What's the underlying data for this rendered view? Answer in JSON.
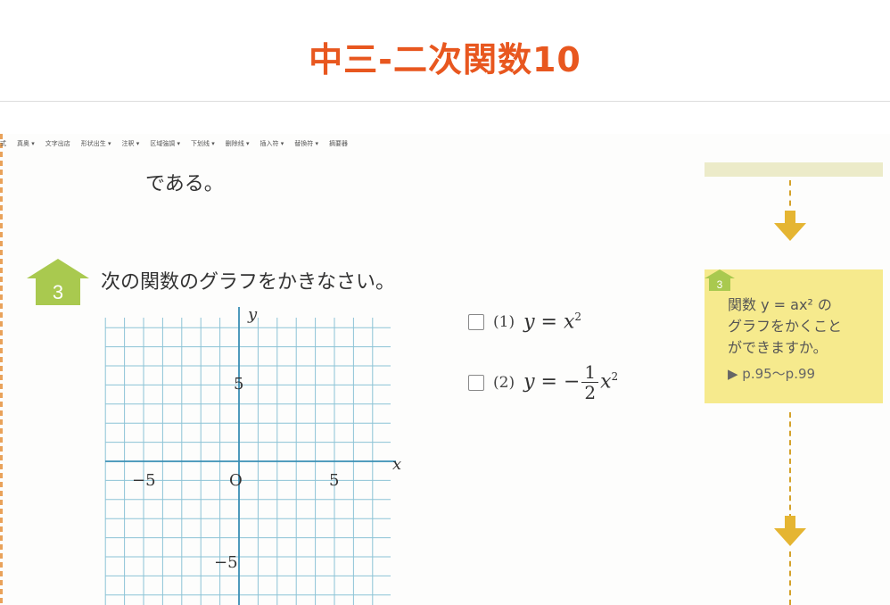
{
  "page": {
    "title": "中三-二次関数10"
  },
  "toolbar": {
    "items": [
      "式",
      "真奥 ▾",
      "文字出店",
      "形状出生 ▾",
      "注釈 ▾",
      "区域強調 ▾",
      "下划线 ▾",
      "删除线 ▾",
      "插入符 ▾",
      "替換符 ▾",
      "摘要器"
    ]
  },
  "document": {
    "preceding_text": "である。",
    "problem_number": "3",
    "problem_text": "次の関数のグラフをかきなさい。",
    "graph": {
      "x_label": "x",
      "y_label": "y",
      "origin_label": "O",
      "x_tick_labels": [
        "−5",
        "5"
      ],
      "y_tick_labels": [
        "5",
        "−5"
      ],
      "x_range": [
        -12,
        14
      ],
      "y_range": [
        -10,
        13
      ]
    },
    "items": [
      {
        "number": "(1)",
        "lhs": "y",
        "eq": " = ",
        "rhs": "x",
        "exp": "2"
      },
      {
        "number": "(2)",
        "lhs": "y",
        "eq": " = −",
        "frac_num": "1",
        "frac_den": "2",
        "rhs": "x",
        "exp": "2"
      }
    ]
  },
  "sidebar": {
    "card_number": "3",
    "card_lines": [
      "関数 y = ax² の",
      "グラフをかくこと",
      "ができますか。"
    ],
    "card_link": "▶ p.95〜p.99"
  },
  "colors": {
    "title": "#e8571f",
    "badge": "#a9c94f",
    "card": "#f6ea8d",
    "arrow": "#e5b532",
    "grid": "#8cc3d6"
  }
}
